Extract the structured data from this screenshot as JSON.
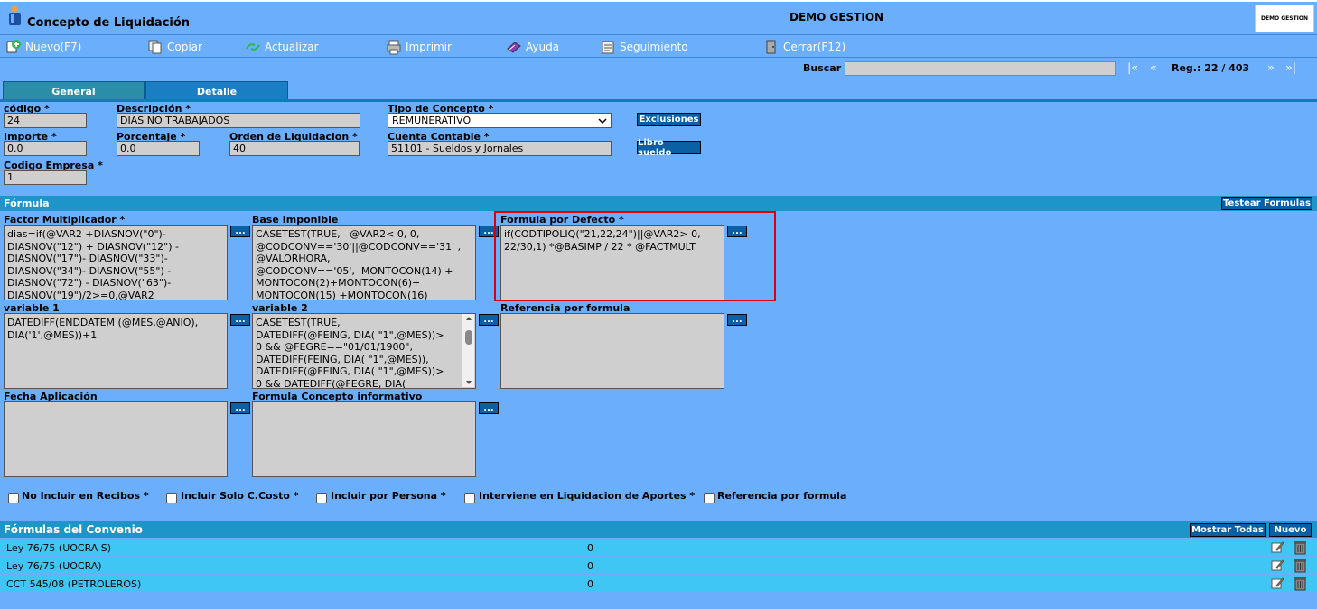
{
  "header": {
    "app_title": "Concepto de Liquidación",
    "company": "DEMO GESTION",
    "logo_text": "DEMO GESTION"
  },
  "toolbar": {
    "items": [
      {
        "label": "Nuevo(F7)",
        "icon": "add-icon"
      },
      {
        "label": "Copiar",
        "icon": "copy-icon"
      },
      {
        "label": "Actualizar",
        "icon": "refresh-icon"
      },
      {
        "label": "Imprimir",
        "icon": "print-icon"
      },
      {
        "label": "Ayuda",
        "icon": "help-book-icon"
      },
      {
        "label": "Seguimiento",
        "icon": "tracking-icon"
      },
      {
        "label": "Cerrar(F12)",
        "icon": "close-door-icon"
      }
    ]
  },
  "search": {
    "label": "Buscar",
    "value": "",
    "first": "|«",
    "prev": "«",
    "next": "»",
    "last": "»|",
    "record": "Reg.: 22 / 403"
  },
  "tabs": [
    {
      "label": "General",
      "active": true
    },
    {
      "label": "Detalle",
      "active": false
    }
  ],
  "form": {
    "codigo_label": "código *",
    "codigo_value": "24",
    "descripcion_label": "Descripción *",
    "descripcion_value": "DIAS NO TRABAJADOS",
    "tipo_label": "Tipo de Concepto *",
    "tipo_value": "REMUNERATIVO",
    "exclusiones_button": "Exclusiones",
    "importe_label": "Importe *",
    "importe_value": "0.0",
    "porcentaje_label": "Porcentaje *",
    "porcentaje_value": "0.0",
    "orden_label": "Orden de Liquidacion *",
    "orden_value": "40",
    "cuenta_label": "Cuenta Contable *",
    "cuenta_value": "51101 - Sueldos y Jornales",
    "libro_button": "Libro sueldo",
    "empresa_label": "Codigo Empresa *",
    "empresa_value": "1"
  },
  "formula": {
    "section_title": "Fórmula",
    "test_button": "Testear Formulas",
    "dots": "...",
    "factor_label": "Factor Multiplicador *",
    "factor_value": "dias=if(@VAR2 +DIASNOV(\"0\")-\nDIASNOV(\"12\") + DIASNOV(\"12\") -\nDIASNOV(\"17\")- DIASNOV(\"33\")-\nDIASNOV(\"34\")- DIASNOV(\"55\") -\nDIASNOV(\"72\") - DIASNOV(\"63\")-\nDIASNOV(\"19\")/2>=0,@VAR2",
    "base_label": "Base Imponible",
    "base_value": "CASETEST(TRUE,   @VAR2< 0, 0,\n@CODCONV=='30'||@CODCONV=='31' ,\n@VALORHORA,\n@CODCONV=='05',  MONTOCON(14) +\nMONTOCON(2)+MONTOCON(6)+\nMONTOCON(15) +MONTOCON(16)",
    "defecto_label": "Formula por Defecto *",
    "defecto_value": "if(CODTIPOLIQ(\"21,22,24\")||@VAR2> 0,\n22/30,1) *@BASIMP / 22 * @FACTMULT",
    "var1_label": "variable 1",
    "var1_value": "DATEDIFF(ENDDATEM (@MES,@ANIO),\nDIA('1',@MES))+1",
    "var2_label": "variable 2",
    "var2_value": "CASETEST(TRUE,\nDATEDIFF(@FEING, DIA( \"1\",@MES))>\n0 && @FEGRE==\"01/01/1900\",\nDATEDIFF(FEING, DIA( \"1\",@MES)),\nDATEDIFF(@FEING, DIA( \"1\",@MES))>\n0 && DATEDIFF(@FEGRE, DIA(",
    "referencia_label": "Referencia por formula",
    "referencia_value": "",
    "fecha_label": "Fecha Aplicación",
    "fecha_value": "",
    "informativo_label": "Formula Concepto informativo",
    "informativo_value": ""
  },
  "checkboxes": [
    {
      "label": "No Incluir en Recibos *",
      "checked": false
    },
    {
      "label": "Incluir Solo C.Costo *",
      "checked": false
    },
    {
      "label": "Incluir por Persona *",
      "checked": false
    },
    {
      "label": "Interviene en Liquidacion de Aportes *",
      "checked": false
    },
    {
      "label": "Referencia por formula",
      "checked": false
    }
  ],
  "convenio": {
    "section_title": "Fórmulas del Convenio",
    "show_all_button": "Mostrar Todas",
    "new_button": "Nuevo",
    "rows": [
      {
        "name": "Ley 76/75 (UOCRA S)",
        "value": "0"
      },
      {
        "name": "Ley 76/75 (UOCRA)",
        "value": "0"
      },
      {
        "name": "CCT 545/08 (PETROLEROS)",
        "value": "0"
      }
    ]
  }
}
